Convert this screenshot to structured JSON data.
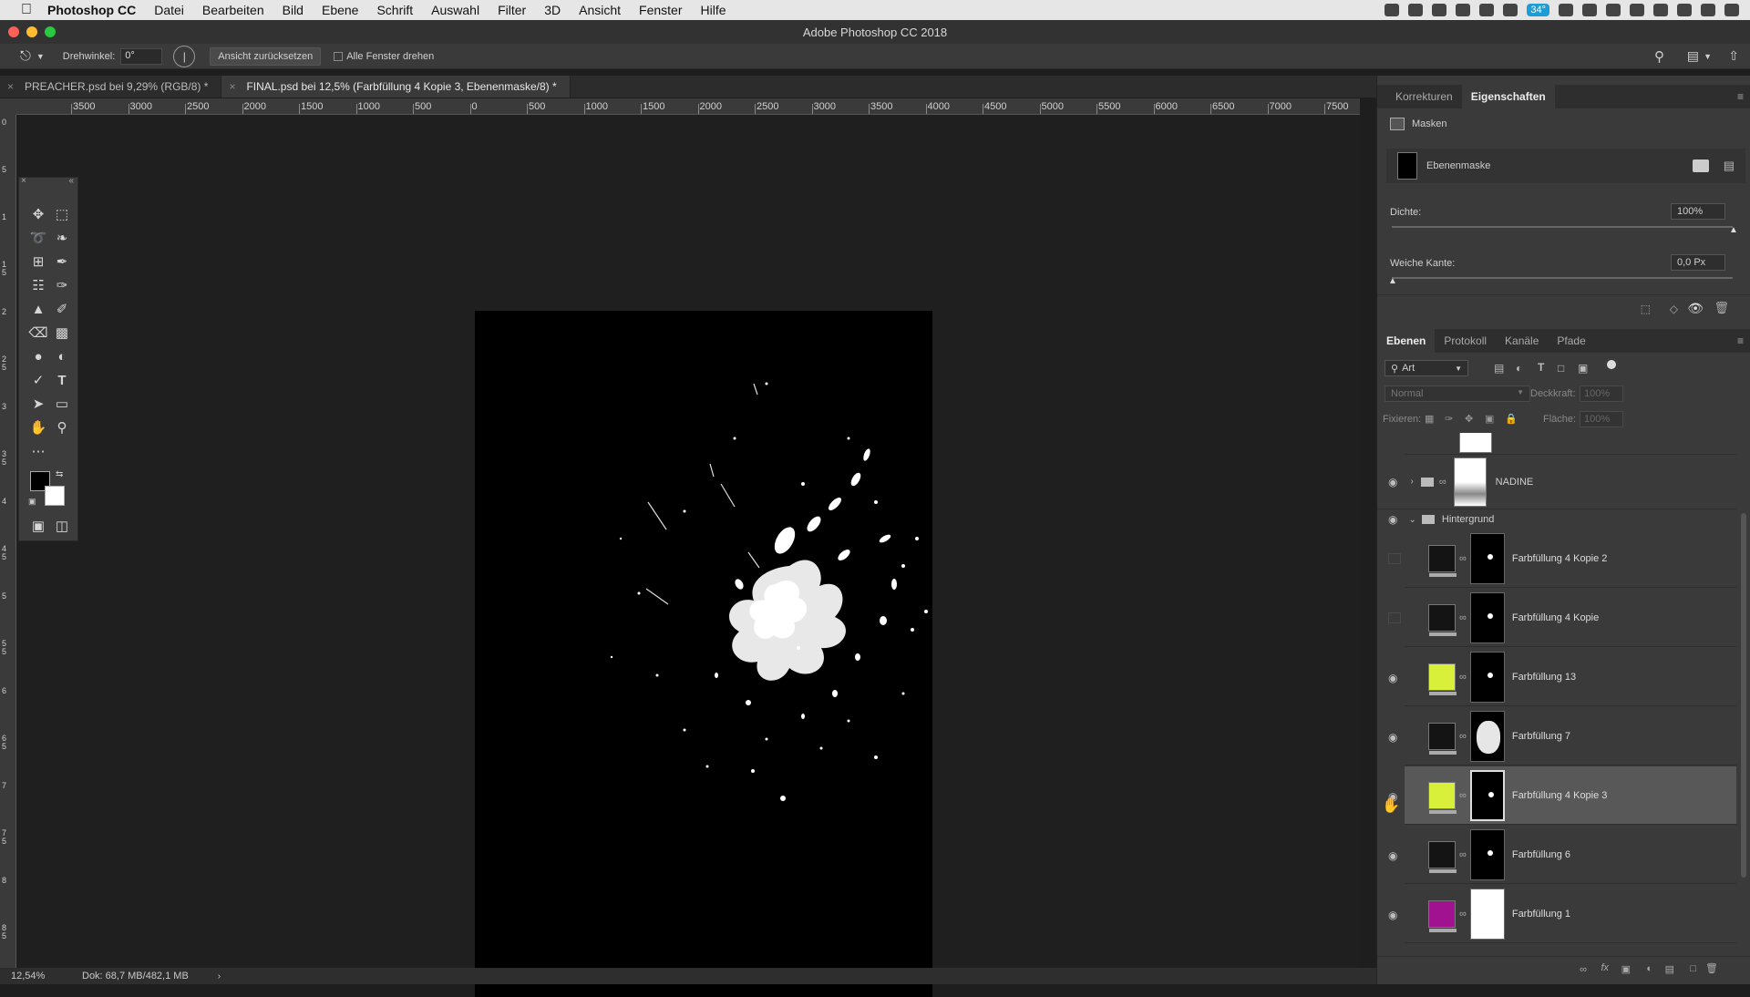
{
  "menubar": {
    "app": "Photoshop CC",
    "items": [
      "Datei",
      "Bearbeiten",
      "Bild",
      "Ebene",
      "Schrift",
      "Auswahl",
      "Filter",
      "3D",
      "Ansicht",
      "Fenster",
      "Hilfe"
    ],
    "battery_badge": "34°"
  },
  "window": {
    "title": "Adobe Photoshop CC 2018"
  },
  "options": {
    "rotate_label": "Drehwinkel:",
    "rotate_value": "0°",
    "reset_view": "Ansicht zurücksetzen",
    "rotate_all": "Alle Fenster drehen"
  },
  "doc_tabs": [
    {
      "label": "PREACHER.psd bei 9,29% (RGB/8) *",
      "active": false
    },
    {
      "label": "FINAL.psd bei 12,5% (Farbfüllung 4 Kopie 3, Ebenenmaske/8) *",
      "active": true
    }
  ],
  "ruler_h": [
    "3500",
    "3000",
    "2500",
    "2000",
    "1500",
    "1000",
    "500",
    "0",
    "500",
    "1000",
    "1500",
    "2000",
    "2500",
    "3000",
    "3500",
    "4000",
    "4500",
    "5000",
    "5500",
    "6000",
    "6500",
    "7000",
    "7500"
  ],
  "ruler_v": [
    "0",
    "5",
    "1",
    "1 5",
    "2",
    "2 5",
    "3",
    "3 5",
    "4",
    "4 5",
    "5",
    "5 5",
    "6",
    "6 5",
    "7",
    "7 5",
    "8",
    "8 5"
  ],
  "status": {
    "zoom": "12,54%",
    "doc": "Dok: 68,7 MB/482,1 MB"
  },
  "properties": {
    "tabs": [
      "Korrekturen",
      "Eigenschaften"
    ],
    "section": "Masken",
    "mask_type": "Ebenenmaske",
    "density_label": "Dichte:",
    "density_value": "100%",
    "density": 1.0,
    "feather_label": "Weiche Kante:",
    "feather_value": "0,0 Px",
    "feather": 0.0
  },
  "layers_panel": {
    "tabs": [
      "Ebenen",
      "Protokoll",
      "Kanäle",
      "Pfade"
    ],
    "filter_kind": "Art",
    "blend_mode": "Normal",
    "opacity_label": "Deckkraft:",
    "opacity_value": "100%",
    "lock_label": "Fixieren:",
    "fill_label": "Fläche:",
    "fill_value": "100%",
    "group_nadine": "NADINE",
    "group_bg": "Hintergrund",
    "layers": [
      {
        "name": "Farbfüllung 4 Kopie 2",
        "color": "#141414",
        "visible": false,
        "selected": false
      },
      {
        "name": "Farbfüllung 4 Kopie",
        "color": "#141414",
        "visible": false,
        "selected": false
      },
      {
        "name": "Farbfüllung 13",
        "color": "#d8f03a",
        "visible": true,
        "selected": false
      },
      {
        "name": "Farbfüllung 7",
        "color": "#141414",
        "visible": true,
        "selected": false
      },
      {
        "name": "Farbfüllung 4 Kopie 3",
        "color": "#d8f03a",
        "visible": true,
        "selected": true
      },
      {
        "name": "Farbfüllung 6",
        "color": "#141414",
        "visible": true,
        "selected": false
      },
      {
        "name": "Farbfüllung 1",
        "color": "#a0128f",
        "visible": true,
        "selected": false
      }
    ]
  }
}
